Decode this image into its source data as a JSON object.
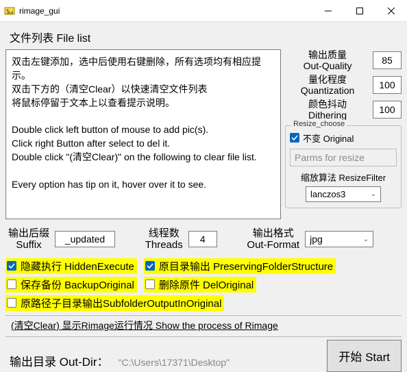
{
  "window": {
    "title": "rimage_gui"
  },
  "filelist": {
    "header": "文件列表 File list",
    "body": "双击左键添加，选中后使用右键删除，所有选项均有相应提示。\n双击下方的（清空Clear）以快速清空文件列表\n将鼠标停留于文本上以查看提示说明。\n\nDouble click left button of mouse to add pic(s).\nClick right Button after select to del it.\nDouble click \"(清空Clear)\" on the following to clear file list.\n\nEvery option has tip on it, hover over it to see."
  },
  "quality": {
    "label": "输出质量\nOut-Quality",
    "value": "85"
  },
  "quant": {
    "label": "量化程度\nQuantization",
    "value": "100"
  },
  "dither": {
    "label": "颜色抖动\nDithering",
    "value": "100"
  },
  "resize": {
    "group": "Resize_choose",
    "nochange": "不变 Original",
    "parms_placeholder": "Parms for resize",
    "filter_label": "缩放算法 ResizeFilter",
    "filter_value": "lanczos3"
  },
  "suffix": {
    "label": "输出后缀\nSuffix",
    "value": "_updated"
  },
  "threads": {
    "label": "线程数\nThreads",
    "value": "4"
  },
  "outformat": {
    "label": "输出格式\nOut-Format",
    "value": "jpg"
  },
  "opts": {
    "hidden": "隐藏执行 HiddenExecute",
    "preserve": "原目录输出 PreservingFolderStructure",
    "backup": "保存备份 BackupOriginal",
    "del": "删除原件 DelOriginal",
    "subfolder": "原路径子目录输出SubfolderOutputInOriginal"
  },
  "process_label": "(清空Clear) 显示Rimage运行情况 Show the process of Rimage",
  "outdir": {
    "label": "输出目录 Out-Dir：",
    "path": "\"C:\\Users\\17371\\Desktop\""
  },
  "start": "开始 Start"
}
